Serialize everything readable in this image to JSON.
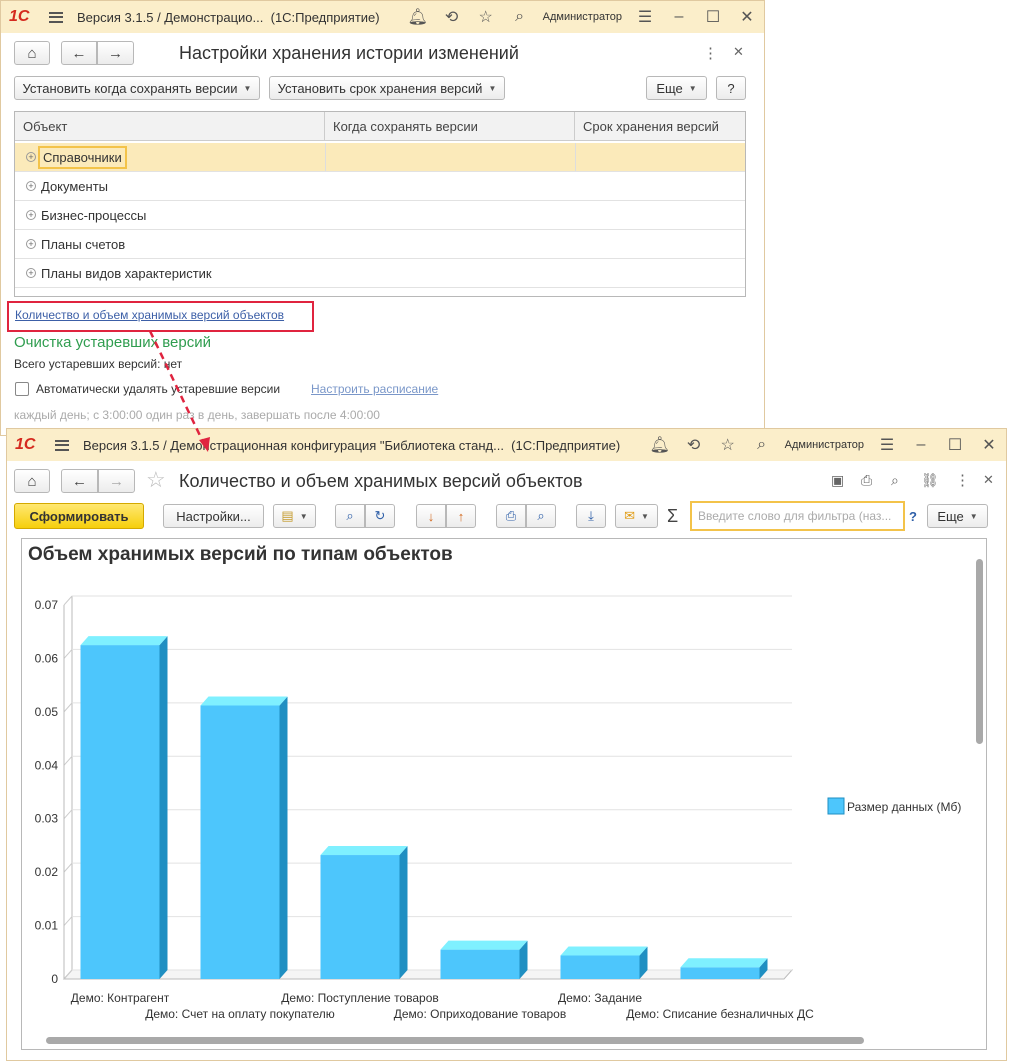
{
  "window1": {
    "app_title": "Версия 3.1.5 / Демонстрацио...",
    "app_suffix": "(1С:Предприятие)",
    "user": "Администратор",
    "form_title": "Настройки хранения истории изменений",
    "buttons": {
      "set_when": "Установить когда сохранять версии",
      "set_term": "Установить срок хранения версий",
      "more": "Еще",
      "help": "?"
    },
    "table": {
      "columns": [
        "Объект",
        "Когда сохранять версии",
        "Срок хранения версий"
      ],
      "rows": [
        "Справочники",
        "Документы",
        "Бизнес-процессы",
        "Планы счетов",
        "Планы видов характеристик"
      ]
    },
    "report_link": "Количество и объем хранимых версий объектов",
    "cleanup_heading": "Очистка устаревших версий",
    "total_obsolete": "Всего устаревших версий: нет",
    "auto_delete_label": "Автоматически удалять устаревшие версии",
    "schedule_link": "Настроить расписание",
    "schedule_text": "каждый день; с 3:00:00 один раз в день, завершать после 4:00:00"
  },
  "window2": {
    "app_title": "Версия 3.1.5 / Демонстрационная конфигурация \"Библиотека станд...",
    "app_suffix": "(1С:Предприятие)",
    "user": "Администратор",
    "form_title": "Количество и объем хранимых версий объектов",
    "generate_button": "Сформировать",
    "settings_button": "Настройки...",
    "more": "Еще",
    "help": "?",
    "sigma": "Σ",
    "filter_placeholder": "Введите слово для фильтра (наз..."
  },
  "chart_data": {
    "type": "bar",
    "title": "Объем хранимых версий по типам объектов",
    "categories": [
      "Демо: Контрагент",
      "Демо: Счет на оплату покупателю",
      "Демо: Поступление товаров",
      "Демо: Оприходование товаров",
      "Демо: Задание",
      "Демо: Списание безналичных ДС"
    ],
    "series": [
      {
        "name": "Размер данных (Мб)",
        "values": [
          0.0625,
          0.0512,
          0.0232,
          0.0055,
          0.0044,
          0.0022
        ]
      }
    ],
    "yticks": [
      "0",
      "0.01",
      "0.02",
      "0.03",
      "0.04",
      "0.05",
      "0.06",
      "0.07"
    ],
    "ylim": [
      0,
      0.07
    ],
    "legend": "right",
    "colors": {
      "front": "#4dc6fc",
      "side": "#1f8fc2",
      "top": "#7ff0ff"
    }
  }
}
